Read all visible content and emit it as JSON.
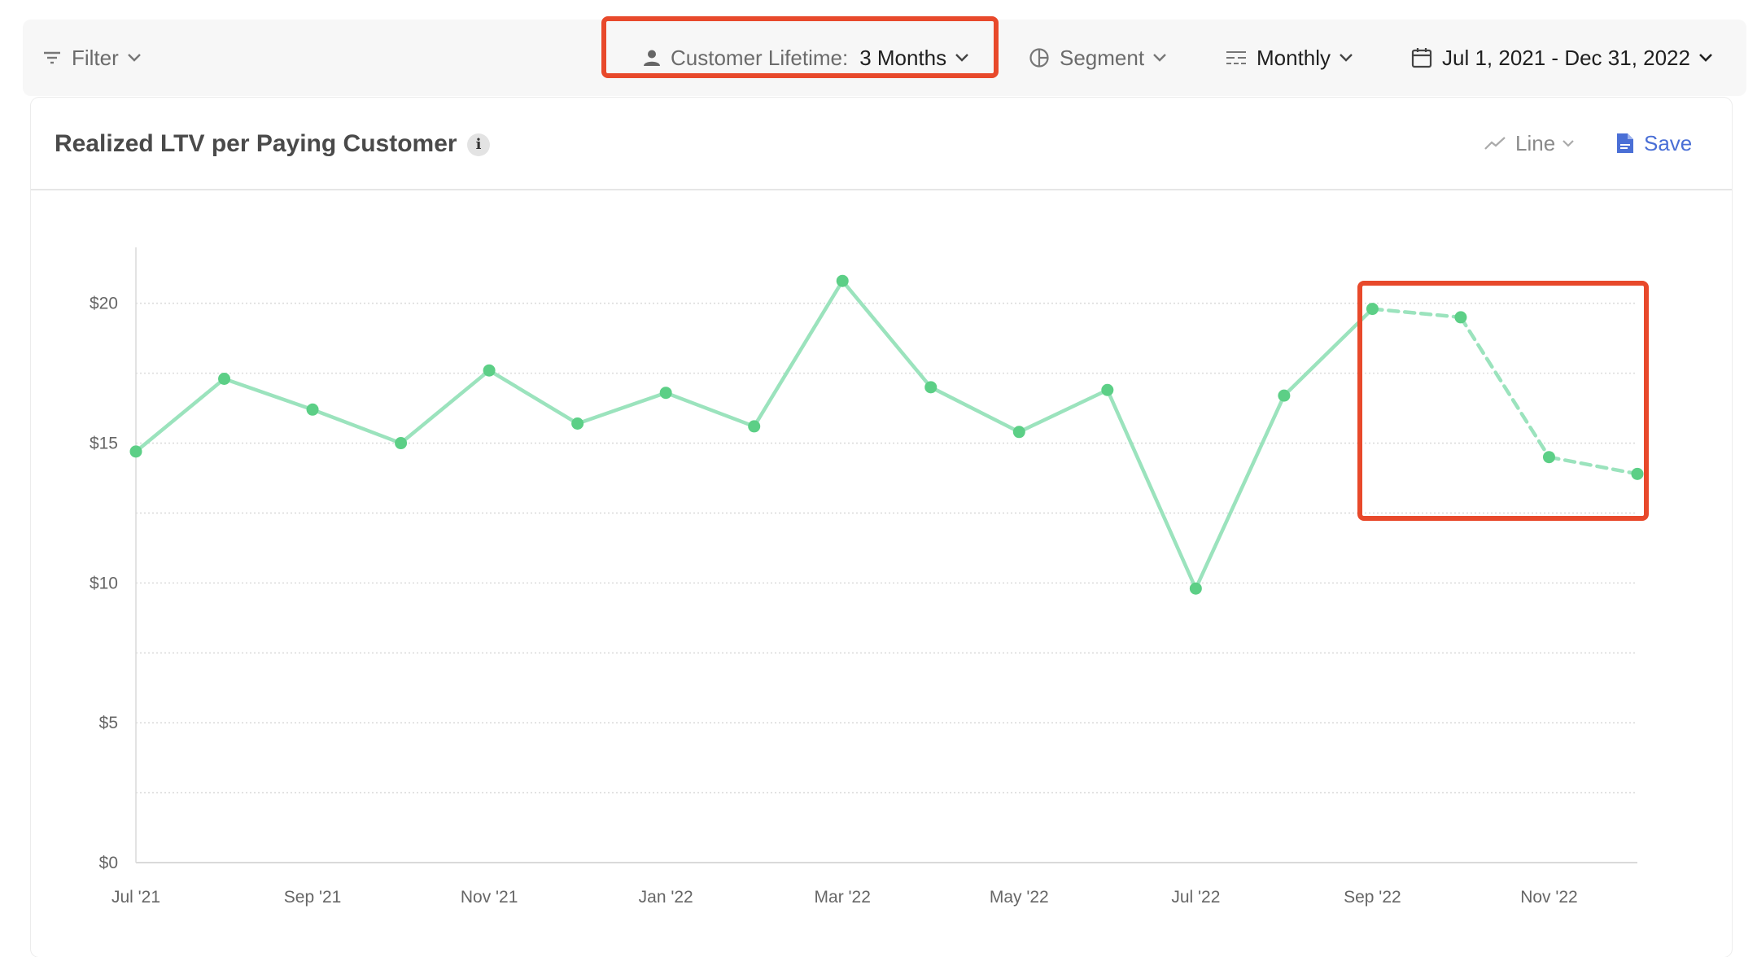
{
  "toolbar": {
    "filter_label": "Filter",
    "lifetime_label": "Customer Lifetime:",
    "lifetime_value": "3 Months",
    "segment_label": "Segment",
    "interval_label": "Monthly",
    "date_range": "Jul 1, 2021 - Dec 31, 2022"
  },
  "card": {
    "title": "Realized LTV per Paying Customer",
    "info_glyph": "i",
    "chart_type_label": "Line",
    "save_label": "Save"
  },
  "colors": {
    "accent_line": "#9be3bd",
    "accent_point": "#5ccf86",
    "highlight": "#e8492b",
    "save_blue": "#4a6fd6"
  },
  "chart_data": {
    "type": "line",
    "title": "Realized LTV per Paying Customer",
    "xlabel": "",
    "ylabel": "",
    "ylim": [
      0,
      22
    ],
    "yticks": [
      0,
      5,
      10,
      15,
      20
    ],
    "ytick_labels": [
      "$0",
      "$5",
      "$10",
      "$15",
      "$20"
    ],
    "x": [
      "Jul '21",
      "Aug '21",
      "Sep '21",
      "Oct '21",
      "Nov '21",
      "Dec '21",
      "Jan '22",
      "Feb '22",
      "Mar '22",
      "Apr '22",
      "May '22",
      "Jun '22",
      "Jul '22",
      "Aug '22",
      "Sep '22",
      "Oct '22",
      "Nov '22",
      "Dec '22"
    ],
    "xtick_labels": [
      "Jul '21",
      "",
      "Sep '21",
      "",
      "Nov '21",
      "",
      "Jan '22",
      "",
      "Mar '22",
      "",
      "May '22",
      "",
      "Jul '22",
      "",
      "Sep '22",
      "",
      "Nov '22",
      ""
    ],
    "series": [
      {
        "values": [
          14.7,
          17.3,
          16.2,
          15.0,
          17.6,
          15.7,
          16.8,
          15.6,
          20.8,
          17.0,
          15.4,
          16.9,
          9.8,
          16.7,
          19.8,
          19.5,
          14.5,
          13.9
        ],
        "dashed_from_index": 14
      }
    ],
    "grid": true,
    "legend": "none"
  }
}
